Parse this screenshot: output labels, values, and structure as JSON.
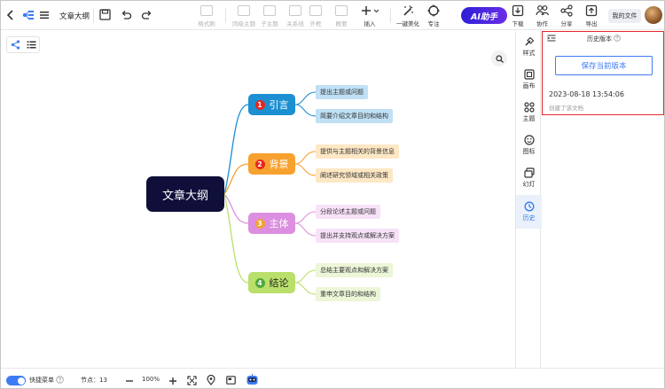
{
  "toolbar": {
    "doc_title": "文章大纲",
    "grey_tools": [
      {
        "label": "格式刷"
      },
      {
        "label": "同级主题"
      },
      {
        "label": "子主题"
      },
      {
        "label": "关系线"
      },
      {
        "label": "外框"
      },
      {
        "label": "概要"
      }
    ],
    "insert_label": "插入",
    "beautify_label": "一键美化",
    "focus_label": "专注",
    "ai_label": "AI助手",
    "download_label": "下载",
    "collab_label": "协作",
    "share_label": "分享",
    "export_label": "导出",
    "my_files_label": "我的文件"
  },
  "mindmap": {
    "root": "文章大纲",
    "branches": [
      {
        "num": "1",
        "label": "引言",
        "color": "#1b8fd2",
        "num_color": "#e8261f",
        "text_color": "#ffffff",
        "leaf_bg": "#bfe0f5",
        "leaves": [
          "提出主题或问题",
          "简要介绍文章目的和结构"
        ]
      },
      {
        "num": "2",
        "label": "背景",
        "color": "#f7a12f",
        "num_color": "#e8261f",
        "text_color": "#ffffff",
        "leaf_bg": "#fde7c4",
        "leaves": [
          "提供与主题相关的背景信息",
          "阐述研究领域或相关政策"
        ]
      },
      {
        "num": "3",
        "label": "主体",
        "color": "#dc8ee0",
        "num_color": "#f3a32f",
        "text_color": "#ffffff",
        "leaf_bg": "#f7e2f8",
        "leaves": [
          "分段论述主题或问题",
          "提出并支持观点或解决方案"
        ]
      },
      {
        "num": "4",
        "label": "结论",
        "color": "#b9e06a",
        "num_color": "#4fa83d",
        "text_color": "#222222",
        "leaf_bg": "#ecf6d8",
        "leaves": [
          "总结主要观点和解决方案",
          "重申文章目的和结构"
        ]
      }
    ]
  },
  "sidebar": {
    "items": [
      {
        "label": "样式",
        "icon": "style-icon"
      },
      {
        "label": "画布",
        "icon": "canvas-icon"
      },
      {
        "label": "主题",
        "icon": "theme-icon"
      },
      {
        "label": "图标",
        "icon": "emoji-icon"
      },
      {
        "label": "幻灯",
        "icon": "slides-icon"
      },
      {
        "label": "历史",
        "icon": "history-icon"
      }
    ]
  },
  "history_panel": {
    "title": "历史版本",
    "save_button": "保存当前版本",
    "versions": [
      {
        "time": "2023-08-18 13:54:06",
        "desc": "创建了该文档"
      }
    ]
  },
  "bottom": {
    "quick_menu_label": "快捷菜单",
    "node_count_label": "节点：13",
    "zoom": "100%"
  },
  "colors": {
    "accent": "#3d7cf4",
    "root_bg": "#0f0f3a",
    "panel_border": "#e5262f"
  }
}
